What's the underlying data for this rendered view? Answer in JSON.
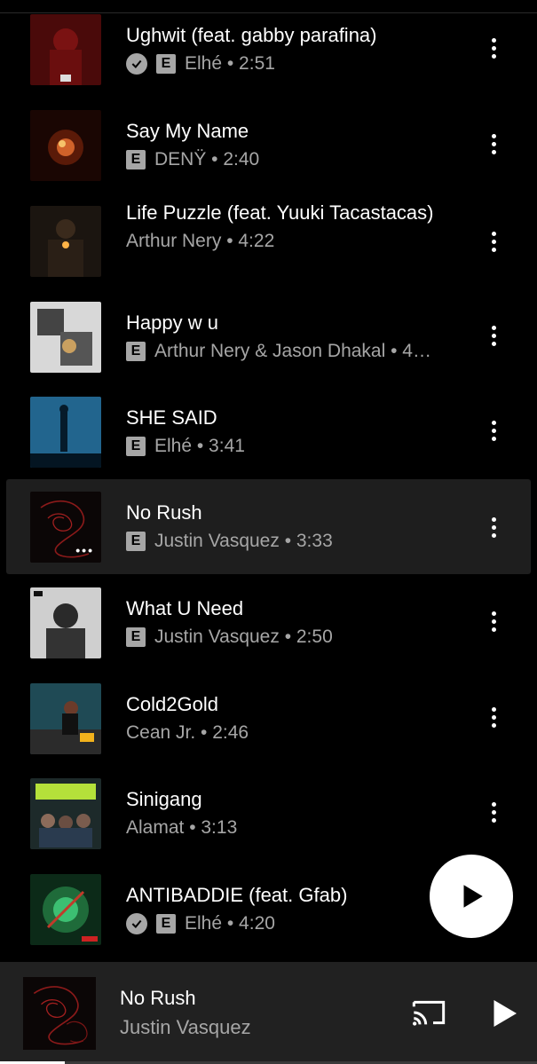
{
  "tracks": [
    {
      "title": "Ughwit (feat. gabby parafina)",
      "meta": "Elhé • 2:51",
      "verified": true,
      "explicit": true,
      "art": "art-red"
    },
    {
      "title": "Say My Name",
      "meta": "DENŸ • 2:40",
      "verified": false,
      "explicit": true,
      "art": "art-ember"
    },
    {
      "title": "Life Puzzle (feat. Yuuki Tacastacas)",
      "meta": "Arthur Nery • 4:22",
      "verified": false,
      "explicit": false,
      "art": "art-portrait-dark"
    },
    {
      "title": "Happy w u",
      "meta": "Arthur Nery & Jason Dhakal • 4…",
      "verified": false,
      "explicit": true,
      "art": "art-bw"
    },
    {
      "title": "SHE SAID",
      "meta": "Elhé • 3:41",
      "verified": false,
      "explicit": true,
      "art": "art-blue"
    },
    {
      "title": "No Rush",
      "meta": "Justin Vasquez • 3:33",
      "verified": false,
      "explicit": true,
      "art": "art-red-line",
      "active": true
    },
    {
      "title": "What U Need",
      "meta": "Justin Vasquez • 2:50",
      "verified": false,
      "explicit": true,
      "art": "art-bw-portrait"
    },
    {
      "title": "Cold2Gold",
      "meta": "Cean Jr. • 2:46",
      "verified": false,
      "explicit": false,
      "art": "art-teal"
    },
    {
      "title": "Sinigang",
      "meta": "Alamat • 3:13",
      "verified": false,
      "explicit": false,
      "art": "art-green-group"
    },
    {
      "title": "ANTIBADDIE (feat. Gfab)",
      "meta": "Elhé • 4:20",
      "verified": true,
      "explicit": true,
      "art": "art-green"
    }
  ],
  "explicit_letter": "E",
  "now_playing": {
    "title": "No Rush",
    "artist": "Justin Vasquez",
    "progress": 0.12
  },
  "icons": {
    "more": "more-vert-icon",
    "verified": "check-circle-icon",
    "play": "play-icon",
    "cast": "cast-icon"
  },
  "colors": {
    "background": "#000000",
    "active_row": "#1e1e1e",
    "player_bar": "#212121",
    "secondary_text": "#a6a6a6"
  }
}
